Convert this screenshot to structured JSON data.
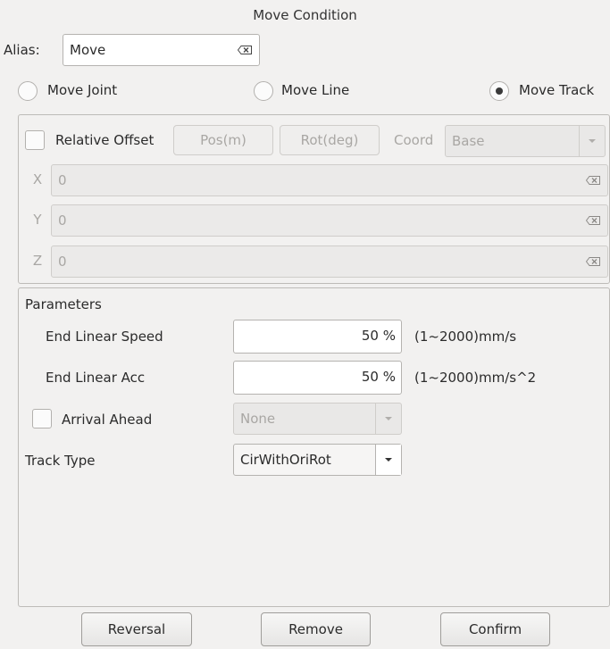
{
  "window": {
    "title": "Move Condition"
  },
  "alias": {
    "label": "Alias:",
    "value": "Move"
  },
  "move_type": {
    "options": [
      {
        "label": "Move Joint",
        "checked": false
      },
      {
        "label": "Move Line",
        "checked": false
      },
      {
        "label": "Move Track",
        "checked": true
      }
    ]
  },
  "offset": {
    "relative_offset_label": "Relative Offset",
    "relative_offset_checked": false,
    "pos_button": "Pos(m)",
    "rot_button": "Rot(deg)",
    "coord_label": "Coord",
    "coord_value": "Base",
    "axes": [
      {
        "label": "X",
        "value": "0"
      },
      {
        "label": "Y",
        "value": "0"
      },
      {
        "label": "Z",
        "value": "0"
      }
    ]
  },
  "parameters": {
    "title": "Parameters",
    "end_linear_speed": {
      "label": "End Linear Speed",
      "value": "50 %",
      "range": "(1~2000)mm/s"
    },
    "end_linear_acc": {
      "label": "End Linear Acc",
      "value": "50 %",
      "range": "(1~2000)mm/s^2"
    },
    "arrival_ahead": {
      "label": "Arrival Ahead",
      "checked": false,
      "value": "None"
    },
    "track_type": {
      "label": "Track Type",
      "value": "CirWithOriRot"
    }
  },
  "footer": {
    "reversal": "Reversal",
    "remove": "Remove",
    "confirm": "Confirm"
  },
  "colors": {
    "background": "#f2f1f0",
    "border": "#b5b3b0",
    "disabled_text": "#a9a7a4"
  }
}
